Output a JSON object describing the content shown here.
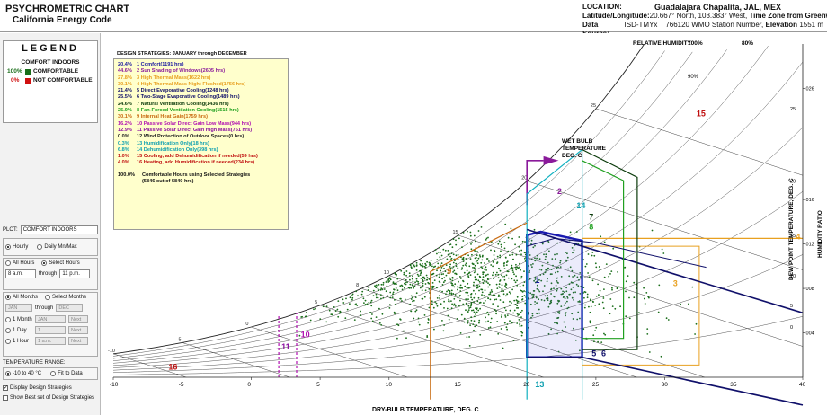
{
  "header": {
    "title": "PSYCHROMETRIC CHART",
    "subtitle": "California Energy Code",
    "location_label": "LOCATION:",
    "location": "Guadalajara Chapalita, JAL, MEX",
    "latlon_label": "Latitude/Longitude:",
    "latlon": "20.667° North, 103.383° West,",
    "timezone_label": "Time Zone from Greenwich",
    "timezone": "-6",
    "datasource_label": "Data Source:",
    "datasource_a": "ISD-TMYx",
    "datasource_b": "766120 WMO Station Number,",
    "elevation_label": "Elevation",
    "elevation": "1551 m"
  },
  "legend": {
    "title": "LEGEND",
    "subtitle": "COMFORT INDOORS",
    "comfortable_pct": "100%",
    "comfortable_label": "COMFORTABLE",
    "not_pct": "0%",
    "not_label": "NOT COMFORTABLE",
    "comfortable_color": "#1a6e1a",
    "not_color": "#d01010"
  },
  "controls": {
    "plot_label": "PLOT:",
    "plot_value": "COMFORT INDOORS",
    "hourly": "Hourly",
    "daily": "Daily Mn/Max",
    "all_hours": "All Hours",
    "select_hours": "Select Hours",
    "hour_from": "8 a.m.",
    "through": "through",
    "hour_to": "11 p.m.",
    "all_months": "All Months",
    "select_months": "Select Months",
    "month_from": "JAN",
    "through2": "through",
    "month_to": "DEC",
    "one_month": "1 Month",
    "one_month_val": "JAN",
    "next": "Next",
    "one_day": "1 Day",
    "one_day_val": "1",
    "one_hour": "1 Hour",
    "one_hour_val": "1 a.m.",
    "temp_range_label": "TEMPERATURE RANGE:",
    "temp_range_a": "-10 to 40 °C",
    "temp_range_b": "Fit to Data",
    "display_ds": "Display Design Strategies",
    "show_best": "Show Best set of Design Strategies"
  },
  "design_strategies": {
    "heading": "DESIGN STRATEGIES: JANUARY through DECEMBER",
    "items": [
      {
        "pct": "20.4%",
        "text": "1 Comfort(1191 hrs)",
        "color": "#1a1aa0"
      },
      {
        "pct": "44.6%",
        "text": "2 Sun Shading of Windows(2605 hrs)",
        "color": "#8a1a9a"
      },
      {
        "pct": "27.8%",
        "text": "3 High Thermal Mass(1622 hrs)",
        "color": "#e8a020"
      },
      {
        "pct": "30.1%",
        "text": "4 High Thermal Mass Night Flushed(1756 hrs)",
        "color": "#e8a020"
      },
      {
        "pct": "21.4%",
        "text": "5 Direct Evaporative Cooling(1248 hrs)",
        "color": "#10106a"
      },
      {
        "pct": "25.5%",
        "text": "6 Two-Stage Evaporative Cooling(1489 hrs)",
        "color": "#10106a"
      },
      {
        "pct": "24.6%",
        "text": "7 Natural Ventilation Cooling(1436 hrs)",
        "color": "#0a3a0a"
      },
      {
        "pct": "25.9%",
        "text": "8 Fan-Forced Ventilation Cooling(1515 hrs)",
        "color": "#20a020"
      },
      {
        "pct": "30.1%",
        "text": "9 Internal Heat Gain(1759 hrs)",
        "color": "#c86a10"
      },
      {
        "pct": "16.2%",
        "text": "10 Passive Solar Direct Gain Low Mass(944 hrs)",
        "color": "#b010b0"
      },
      {
        "pct": "12.9%",
        "text": "11 Passive Solar Direct Gain High Mass(751 hrs)",
        "color": "#8a10a0"
      },
      {
        "pct": "0.0%",
        "text": "12 Wind Protection of Outdoor Spaces(0 hrs)",
        "color": "#202020"
      },
      {
        "pct": "0.3%",
        "text": "13 Humidification Only(18 hrs)",
        "color": "#10a0b0"
      },
      {
        "pct": "6.8%",
        "text": "14 Dehumidification Only(398 hrs)",
        "color": "#10a0b0"
      },
      {
        "pct": "1.0%",
        "text": "15 Cooling, add Dehumidification if needed(59 hrs)",
        "color": "#c01010"
      },
      {
        "pct": "4.0%",
        "text": "16 Heating, add Humidification if needed(234 hrs)",
        "color": "#c01010"
      }
    ],
    "total_pct": "100.0%",
    "total_text": "Comfortable Hours using Selected Strategies",
    "total_sub": "(5846 out of 5840 hrs)"
  },
  "chart_data": {
    "type": "scatter",
    "xlabel": "DRY-BULB TEMPERATURE, DEG. C",
    "ylabel_right_outer": "HUMIDITY RATIO",
    "ylabel_right_inner": "DEW POINT TEMPERATURE, DEG. C",
    "top_label": "RELATIVE HUMIDITY",
    "wetbulb_label_1": "WET BULB",
    "wetbulb_label_2": "TEMPERATURE",
    "wetbulb_label_3": "DEG. C",
    "x_range": [
      -10,
      40
    ],
    "y_range": [
      0,
      0.03
    ],
    "x_ticks": [
      -10,
      -5,
      0,
      5,
      10,
      15,
      20,
      25,
      30,
      35,
      40
    ],
    "hr_ticks": [
      0.004,
      0.008,
      0.012,
      0.016,
      0.026
    ],
    "hr_tick_labels": [
      ".004",
      ".008",
      ".012",
      ".016",
      ".026"
    ],
    "dp_ticks": [
      0,
      5,
      10,
      15,
      20,
      25
    ],
    "rh_top_labels": [
      "100%",
      "80%"
    ],
    "rh_curves": [
      1.0,
      0.9,
      0.8,
      0.7,
      0.6,
      0.5,
      0.4,
      0.3,
      0.2,
      0.1
    ],
    "rh_inline_label": "90%",
    "wetbulb_values": [
      -10,
      -5,
      0,
      5,
      8,
      10,
      15,
      20,
      25,
      30
    ],
    "strategy_labels": [
      {
        "n": "1",
        "x": 20.6,
        "y": 0.0085
      },
      {
        "n": "2",
        "x": 22.2,
        "y": 0.0165
      },
      {
        "n": "3",
        "x": 30.6,
        "y": 0.0082
      },
      {
        "n": "4",
        "x": 39.5,
        "y": 0.0124
      },
      {
        "n": "5",
        "x": 24.7,
        "y": 0.0019
      },
      {
        "n": "6",
        "x": 25.4,
        "y": 0.0019
      },
      {
        "n": "7",
        "x": 24.5,
        "y": 0.0142
      },
      {
        "n": "8",
        "x": 24.5,
        "y": 0.0133
      },
      {
        "n": "9",
        "x": 14.2,
        "y": 0.0093
      },
      {
        "n": "10",
        "x": 3.6,
        "y": 0.0036
      },
      {
        "n": "11",
        "x": 2.2,
        "y": 0.0025
      },
      {
        "n": "13",
        "x": 20.6,
        "y": -0.0009
      },
      {
        "n": "14",
        "x": 23.6,
        "y": 0.0152
      },
      {
        "n": "15",
        "x": 32.3,
        "y": 0.0235
      },
      {
        "n": "16",
        "x": -6.0,
        "y": 0.0007
      }
    ],
    "comfort_hours": 1191,
    "scatter_points_shown": 1200
  }
}
